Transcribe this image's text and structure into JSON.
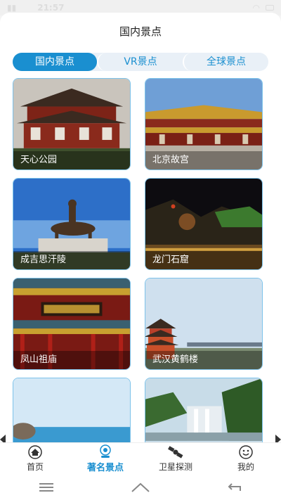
{
  "status_bar": {
    "time": "21:57"
  },
  "header": {
    "title": "国内景点"
  },
  "tabs": [
    {
      "label": "国内景点",
      "active": true
    },
    {
      "label": "VR景点",
      "active": false
    },
    {
      "label": "全球景点",
      "active": false
    }
  ],
  "cards": [
    {
      "label": "天心公园",
      "scene": "pavilion"
    },
    {
      "label": "北京故宫",
      "scene": "palace"
    },
    {
      "label": "成吉思汗陵",
      "scene": "statue"
    },
    {
      "label": "龙门石窟",
      "scene": "night"
    },
    {
      "label": "凤山祖庙",
      "scene": "temple"
    },
    {
      "label": "武汉黄鹤楼",
      "scene": "tower"
    },
    {
      "label": "",
      "scene": "beach"
    },
    {
      "label": "",
      "scene": "waterfall"
    }
  ],
  "bottom_nav": [
    {
      "label": "首页",
      "icon": "home-icon",
      "active": false
    },
    {
      "label": "著名景点",
      "icon": "camera-icon",
      "active": true
    },
    {
      "label": "卫星探测",
      "icon": "satellite-icon",
      "active": false
    },
    {
      "label": "我的",
      "icon": "smiley-icon",
      "active": false
    }
  ],
  "colors": {
    "accent": "#1a8fd0",
    "tab_bg": "#e9f0f7",
    "card_border": "#7cc2ea"
  }
}
